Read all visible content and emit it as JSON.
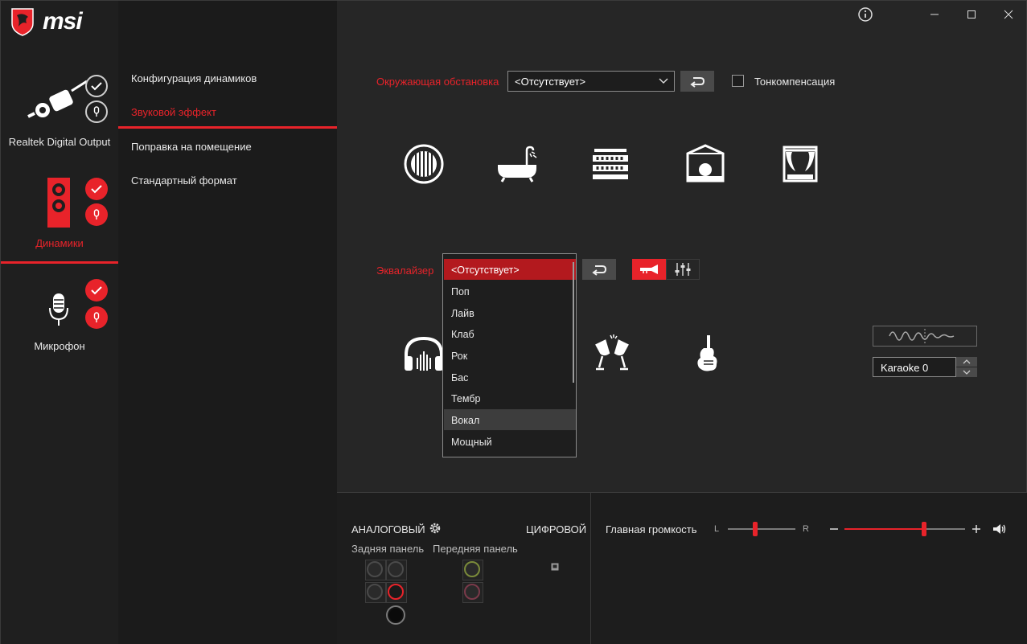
{
  "app": {
    "logo_text": "msi"
  },
  "devices": [
    {
      "label": "Realtek Digital Output",
      "icon": "digital-jack-icon"
    },
    {
      "label": "Динамики",
      "icon": "speaker-icon",
      "active": true
    },
    {
      "label": "Микрофон",
      "icon": "microphone-icon"
    }
  ],
  "submenu": [
    {
      "label": "Конфигурация динамиков"
    },
    {
      "label": "Звуковой эффект",
      "active": true
    },
    {
      "label": "Поправка на помещение"
    },
    {
      "label": "Стандартный формат"
    }
  ],
  "environment": {
    "label": "Окружающая обстановка",
    "selected": "<Отсутствует>",
    "loudness_label": "Тонкомпенсация",
    "loudness_checked": false,
    "icons": [
      "sewer-pipe-icon",
      "bathroom-icon",
      "colosseum-icon",
      "stone-room-icon",
      "theater-icon"
    ]
  },
  "equalizer": {
    "label": "Эквалайзер",
    "selected": "<Отсутствует>",
    "options": [
      "<Отсутствует>",
      "Поп",
      "Лайв",
      "Клаб",
      "Рок",
      "Бас",
      "Тембр",
      "Вокал",
      "Мощный"
    ],
    "hovered": "Вокал",
    "icons": [
      "headphones-icon",
      "cheers-icon",
      "guitar-icon"
    ]
  },
  "karaoke": {
    "value": "Karaoke 0"
  },
  "bottom": {
    "analog_label": "АНАЛОГОВЫЙ",
    "digital_label": "ЦИФРОВОЙ",
    "rear_panel_label": "Задняя панель",
    "front_panel_label": "Передняя панель",
    "master_volume_label": "Главная громкость",
    "balance_left": "L",
    "balance_right": "R",
    "balance_position": 0.4,
    "volume_level": 0.66
  },
  "colors": {
    "accent": "#e8232a",
    "background": "#262626",
    "sidebar": "#1f1f1f"
  }
}
